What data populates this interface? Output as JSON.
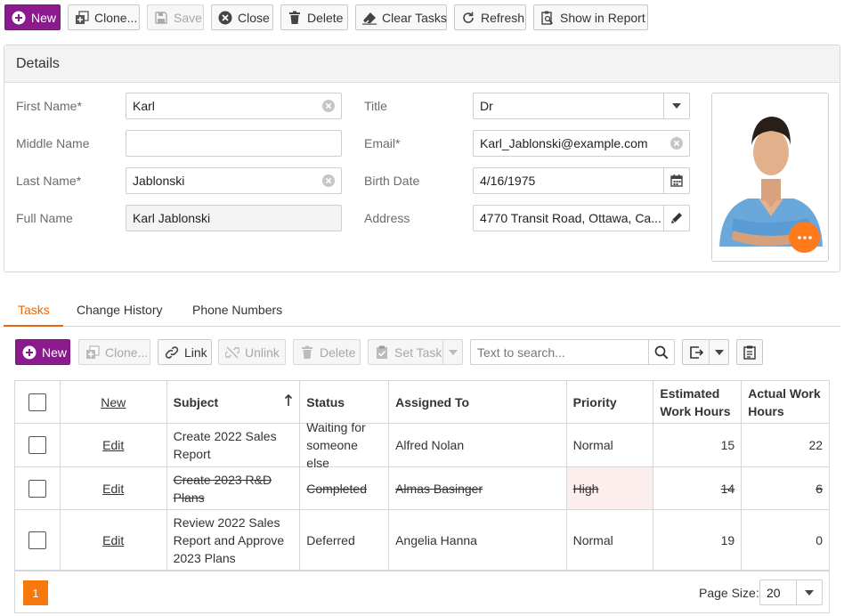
{
  "toolbar": {
    "new": "New",
    "clone": "Clone...",
    "save": "Save",
    "close": "Close",
    "delete": "Delete",
    "clear_tasks": "Clear Tasks",
    "refresh": "Refresh",
    "show_in_report": "Show in Report"
  },
  "details": {
    "title": "Details",
    "labels": {
      "first_name": "First Name*",
      "middle_name": "Middle Name",
      "last_name": "Last Name*",
      "full_name": "Full Name",
      "title": "Title",
      "email": "Email*",
      "birth_date": "Birth Date",
      "address": "Address"
    },
    "values": {
      "first_name": "Karl",
      "middle_name": "",
      "last_name": "Jablonski",
      "full_name": "Karl Jablonski",
      "title": "Dr",
      "email": "Karl_Jablonski@example.com",
      "birth_date": "4/16/1975",
      "address": "4770 Transit Road, Ottawa, Ca..."
    }
  },
  "tabs": [
    "Tasks",
    "Change History",
    "Phone Numbers"
  ],
  "active_tab": "Tasks",
  "tasks_toolbar": {
    "new": "New",
    "clone": "Clone...",
    "link": "Link",
    "unlink": "Unlink",
    "delete": "Delete",
    "set_task": "Set Task",
    "search_placeholder": "Text to search..."
  },
  "grid": {
    "headers": {
      "new": "New",
      "subject": "Subject",
      "status": "Status",
      "assigned_to": "Assigned To",
      "priority": "Priority",
      "estimated": "Estimated Work Hours",
      "actual": "Actual Work Hours"
    },
    "edit_label": "Edit",
    "rows": [
      {
        "subject": "Create 2022 Sales Report",
        "status": "Waiting for someone else",
        "assigned_to": "Alfred Nolan",
        "priority": "Normal",
        "estimated": "15",
        "actual": "22",
        "completed": false
      },
      {
        "subject": "Create 2023 R&D Plans",
        "status": "Completed",
        "assigned_to": "Almas Basinger",
        "priority": "High",
        "estimated": "14",
        "actual": "6",
        "completed": true
      },
      {
        "subject": "Review 2022 Sales Report and Approve 2023 Plans",
        "status": "Deferred",
        "assigned_to": "Angelia Hanna",
        "priority": "Normal",
        "estimated": "19",
        "actual": "0",
        "completed": false
      }
    ]
  },
  "pager": {
    "current_page": "1",
    "page_size_label": "Page Size:",
    "page_size": "20"
  },
  "colors": {
    "primary": "#8a1a8e",
    "accent": "#e8660a",
    "fab": "#ff7a1a",
    "high_priority_bg": "#fdeeee"
  }
}
